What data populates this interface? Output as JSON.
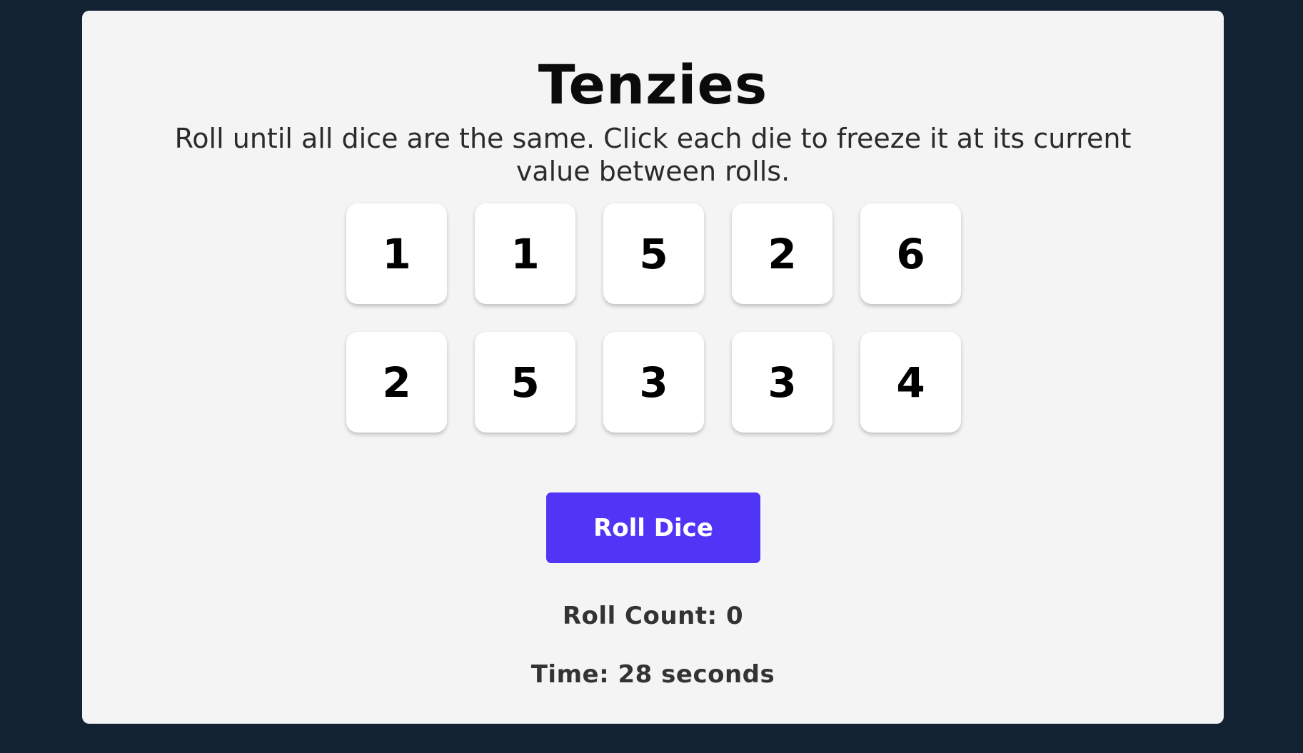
{
  "colors": {
    "page_background": "#132232",
    "panel_background": "#f4f4f4",
    "die_background": "#ffffff",
    "button_accent": "#5035f7"
  },
  "game": {
    "title": "Tenzies",
    "instructions": "Roll until all dice are the same. Click each die to freeze it at its current value between rolls.",
    "dice": [
      {
        "value": "1"
      },
      {
        "value": "1"
      },
      {
        "value": "5"
      },
      {
        "value": "2"
      },
      {
        "value": "6"
      },
      {
        "value": "2"
      },
      {
        "value": "5"
      },
      {
        "value": "3"
      },
      {
        "value": "3"
      },
      {
        "value": "4"
      }
    ],
    "roll_button_label": "Roll Dice",
    "roll_count_text": "Roll Count: 0",
    "time_text": "Time: 28 seconds"
  }
}
